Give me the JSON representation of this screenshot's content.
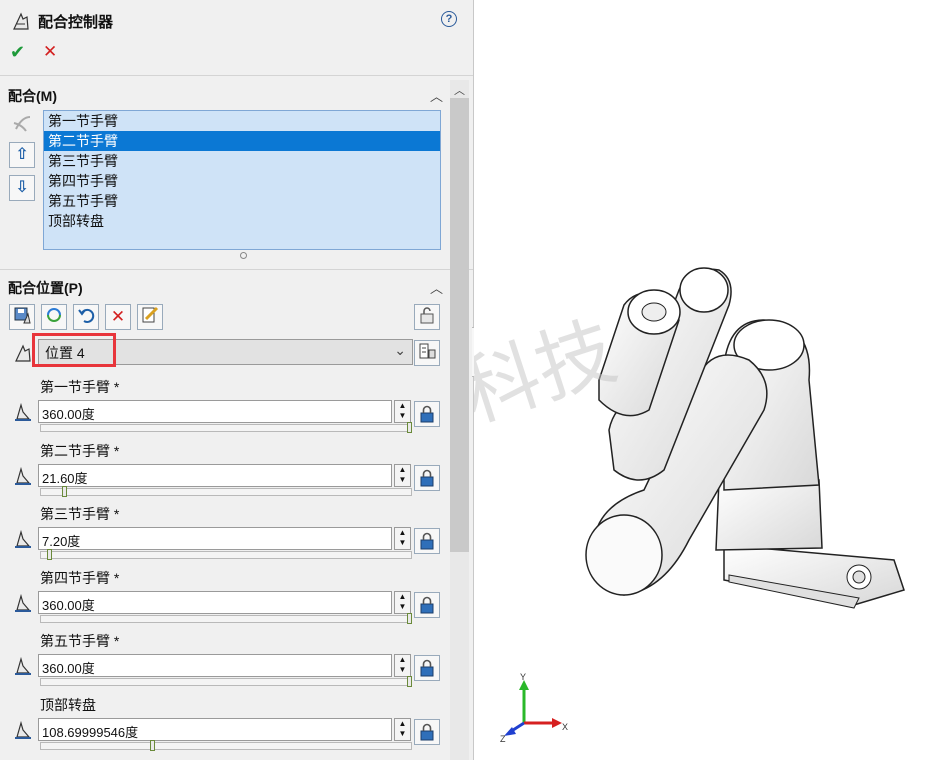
{
  "header": {
    "title": "配合控制器",
    "help": "?",
    "ok": "✔",
    "cancel": "✕"
  },
  "mates": {
    "section_title": "配合(M)",
    "items": [
      "第一节手臂",
      "第二节手臂",
      "第三节手臂",
      "第四节手臂",
      "第五节手臂",
      "顶部转盘"
    ],
    "selected_index": 1
  },
  "positions": {
    "section_title": "配合位置(P)",
    "selected_position": "位置 4",
    "params": [
      {
        "label": "第一节手臂 *",
        "value": "360.00度",
        "slider_fraction": 1.0
      },
      {
        "label": "第二节手臂 *",
        "value": "21.60度",
        "slider_fraction": 0.06
      },
      {
        "label": "第三节手臂 *",
        "value": "7.20度",
        "slider_fraction": 0.02
      },
      {
        "label": "第四节手臂 *",
        "value": "360.00度",
        "slider_fraction": 1.0
      },
      {
        "label": "第五节手臂 *",
        "value": "360.00度",
        "slider_fraction": 1.0
      },
      {
        "label": "顶部转盘",
        "value": "108.69999546度",
        "slider_fraction": 0.3
      }
    ]
  },
  "watermark": "生信科技",
  "triad": {
    "x": "X",
    "y": "Y",
    "z": "Z"
  },
  "colors": {
    "accent": "#0b78d4",
    "highlight": "#e8353b",
    "list_bg": "#cfe3f7"
  }
}
